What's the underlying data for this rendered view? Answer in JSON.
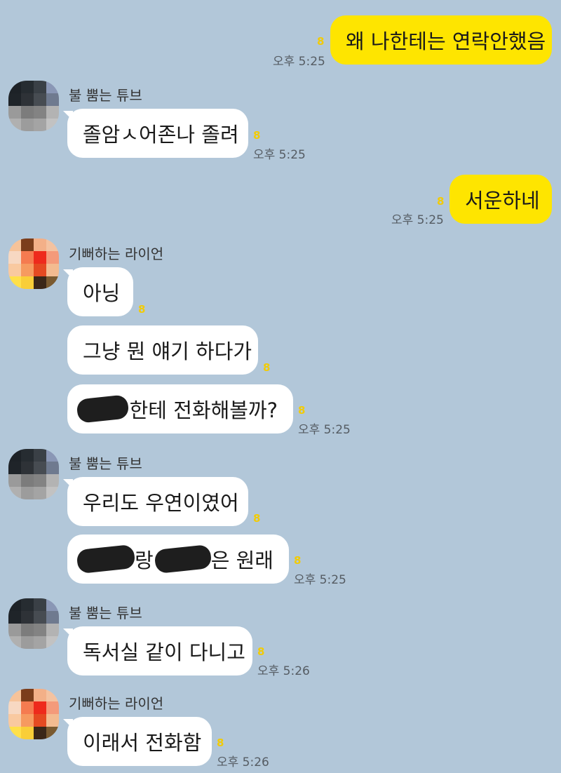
{
  "senders": {
    "tube": "불 뿜는 튜브",
    "ryan": "기뻐하는 라이언"
  },
  "unread_mark": "8",
  "messages": {
    "m1": {
      "text": "왜 나한테는 연락안했음",
      "time": "오후 5:25"
    },
    "m2": {
      "text": "졸암ㅅ어존나 졸려",
      "time": "오후 5:25"
    },
    "m3": {
      "text": "서운하네",
      "time": "오후 5:25"
    },
    "m4": {
      "text": "아닝"
    },
    "m5": {
      "text": "그냥 뭔 얘기 하다가"
    },
    "m6": {
      "text": "한테 전화해볼까?",
      "time": "오후 5:25"
    },
    "m7": {
      "text": "우리도 우연이였어"
    },
    "m8": {
      "part1": "랑",
      "part2": "은 원래",
      "time": "오후 5:25"
    },
    "m9": {
      "text": "독서실 같이 다니고",
      "time": "오후 5:26"
    },
    "m10": {
      "text": "이래서 전화함",
      "time": "오후 5:26"
    }
  },
  "colors": {
    "background": "#b2c7d9",
    "my_bubble": "#fee500",
    "their_bubble": "#ffffff",
    "unread": "#f2cb05"
  },
  "icons": {
    "tube_avatar": "pixelated-avatar-dark",
    "ryan_avatar": "pixelated-avatar-ryan"
  }
}
